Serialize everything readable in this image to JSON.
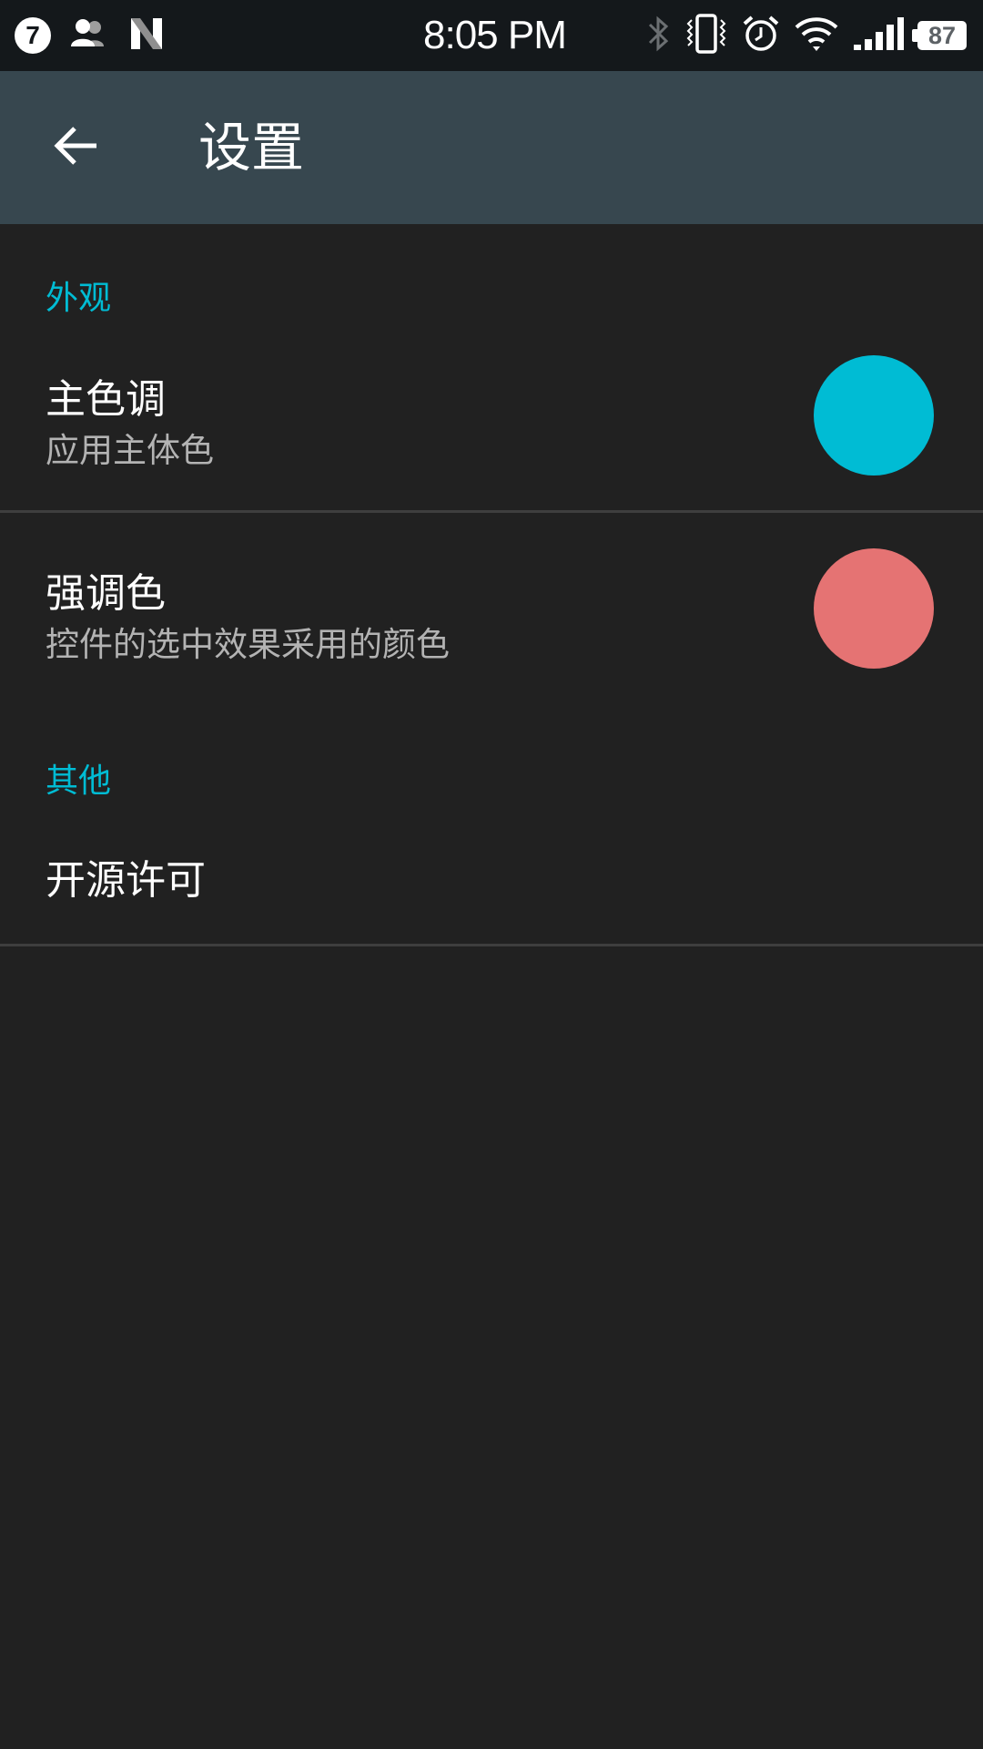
{
  "status_bar": {
    "notification_count": "7",
    "time": "8:05 PM",
    "battery_level": "87",
    "icons": [
      "notification-count-icon",
      "contacts-icon",
      "n-logo-icon",
      "bluetooth-icon",
      "vibrate-icon",
      "alarm-icon",
      "wifi-icon",
      "signal-icon",
      "battery-icon"
    ]
  },
  "app_bar": {
    "title": "设置",
    "back_icon": "arrow-back-icon"
  },
  "sections": [
    {
      "header": "外观",
      "items": [
        {
          "title": "主色调",
          "summary": "应用主体色",
          "color": "#00bcd4"
        },
        {
          "title": "强调色",
          "summary": "控件的选中效果采用的颜色",
          "color": "#e57373"
        }
      ]
    },
    {
      "header": "其他",
      "items": [
        {
          "title": "开源许可"
        }
      ]
    }
  ],
  "colors": {
    "background": "#212121",
    "app_bar": "#37474f",
    "status_bar": "#14181b",
    "accent": "#00bcd4"
  }
}
